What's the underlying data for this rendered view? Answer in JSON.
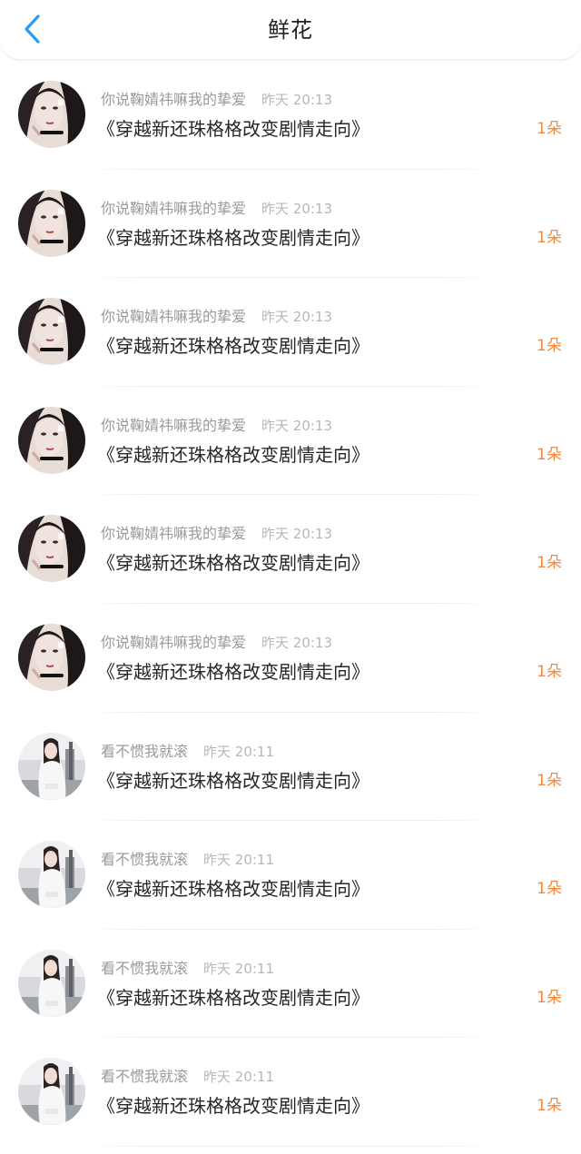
{
  "header": {
    "title": "鲜花",
    "back_icon": "chevron-left-icon",
    "accent_color": "#2c9cf0"
  },
  "colors": {
    "count": "#f5883b",
    "meta": "#9a9a9a",
    "title": "#262626"
  },
  "items": [
    {
      "user": "你说鞠婧祎嘛我的挚爱",
      "time": "昨天 20:13",
      "book": "《穿越新还珠格格改变剧情走向》",
      "count": "1朵",
      "avatar": "avatar-dark-hair-girl"
    },
    {
      "user": "你说鞠婧祎嘛我的挚爱",
      "time": "昨天 20:13",
      "book": "《穿越新还珠格格改变剧情走向》",
      "count": "1朵",
      "avatar": "avatar-dark-hair-girl"
    },
    {
      "user": "你说鞠婧祎嘛我的挚爱",
      "time": "昨天 20:13",
      "book": "《穿越新还珠格格改变剧情走向》",
      "count": "1朵",
      "avatar": "avatar-dark-hair-girl"
    },
    {
      "user": "你说鞠婧祎嘛我的挚爱",
      "time": "昨天 20:13",
      "book": "《穿越新还珠格格改变剧情走向》",
      "count": "1朵",
      "avatar": "avatar-dark-hair-girl"
    },
    {
      "user": "你说鞠婧祎嘛我的挚爱",
      "time": "昨天 20:13",
      "book": "《穿越新还珠格格改变剧情走向》",
      "count": "1朵",
      "avatar": "avatar-dark-hair-girl"
    },
    {
      "user": "你说鞠婧祎嘛我的挚爱",
      "time": "昨天 20:13",
      "book": "《穿越新还珠格格改变剧情走向》",
      "count": "1朵",
      "avatar": "avatar-dark-hair-girl"
    },
    {
      "user": "看不惯我就滚",
      "time": "昨天 20:11",
      "book": "《穿越新还珠格格改变剧情走向》",
      "count": "1朵",
      "avatar": "avatar-girl-white-shirt"
    },
    {
      "user": "看不惯我就滚",
      "time": "昨天 20:11",
      "book": "《穿越新还珠格格改变剧情走向》",
      "count": "1朵",
      "avatar": "avatar-girl-white-shirt"
    },
    {
      "user": "看不惯我就滚",
      "time": "昨天 20:11",
      "book": "《穿越新还珠格格改变剧情走向》",
      "count": "1朵",
      "avatar": "avatar-girl-white-shirt"
    },
    {
      "user": "看不惯我就滚",
      "time": "昨天 20:11",
      "book": "《穿越新还珠格格改变剧情走向》",
      "count": "1朵",
      "avatar": "avatar-girl-white-shirt"
    }
  ]
}
